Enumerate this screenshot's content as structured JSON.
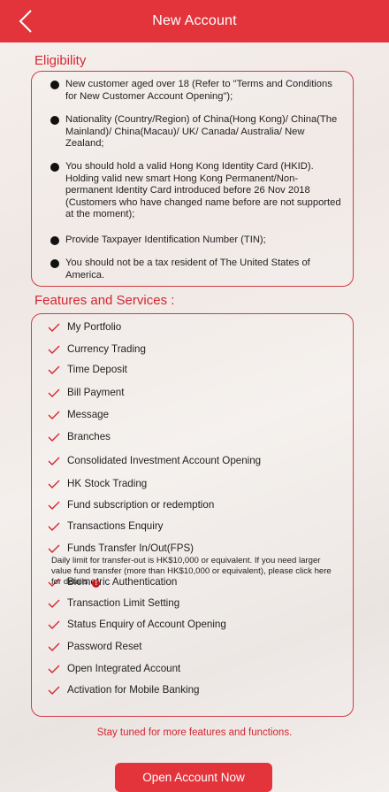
{
  "header": {
    "title": "New Account",
    "back_icon": "chevron-left-icon"
  },
  "eligibility": {
    "title": "Eligibility",
    "items": [
      "New customer aged over 18 (Refer to \"Terms and Conditions for New Customer Account Opening\");",
      "Nationality (Country/Region) of China(Hong Kong)/ China(The Mainland)/ China(Macau)/ UK/ Canada/ Australia/ New Zealand;",
      "You should hold a valid Hong Kong Identity Card (HKID). Holding valid new smart Hong Kong Permanent/Non-permanent Identity Card introduced before 26 Nov 2018 (Customers who have changed name before are not supported at the moment);",
      "Provide Taxpayer Identification Number (TIN);",
      "You should not be a tax resident of The United States of America."
    ]
  },
  "features": {
    "title": "Features and Services :",
    "items": [
      "My Portfolio",
      "Currency Trading",
      "Time Deposit",
      "Bill Payment",
      "Message",
      "Branches",
      "Consolidated Investment Account Opening",
      "HK Stock Trading",
      "Fund subscription or redemption",
      "Transactions Enquiry",
      "Funds Transfer In/Out(FPS)",
      "Biometric Authentication",
      "Transaction Limit Setting",
      "Status Enquiry of Account Opening",
      "Password Reset",
      "Open Integrated Account",
      "Activation for Mobile Banking"
    ],
    "fps_note": "Daily limit for transfer-out is HK$10,000 or equivalent. If you need larger value fund transfer (more than HK$10,000 or equivalent), please click here for details.",
    "info_icon_glyph": "!"
  },
  "footer": {
    "stay_tuned": "Stay tuned for more features and functions.",
    "open_button": "Open Account Now"
  },
  "colors": {
    "brand_red": "#e3343c",
    "accent_red": "#d3272f"
  }
}
